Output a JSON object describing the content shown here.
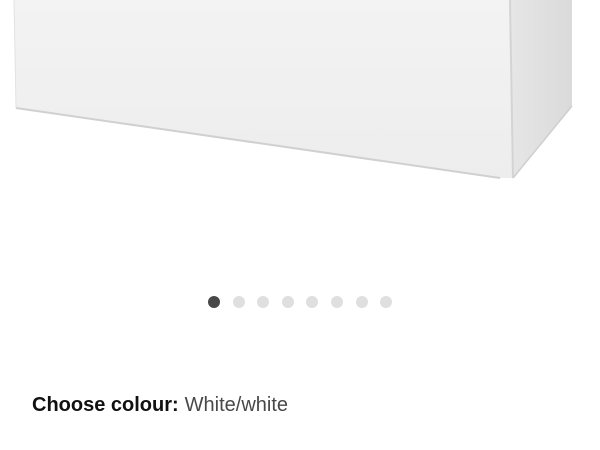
{
  "product": {
    "image_alt": "White storage bench"
  },
  "carousel": {
    "total": 8,
    "active_index": 0
  },
  "colour": {
    "label": "Choose colour:",
    "value": "White/white"
  },
  "colors": {
    "dot_active": "#484848",
    "dot_inactive": "#dfdfdf"
  }
}
